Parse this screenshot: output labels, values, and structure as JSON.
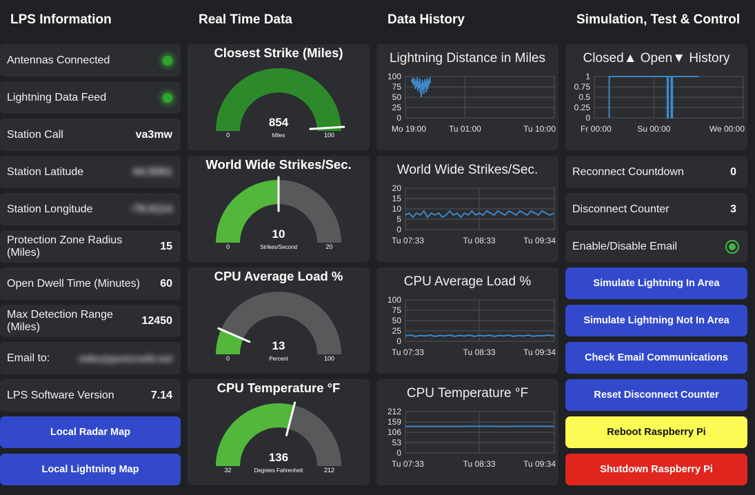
{
  "columns": {
    "info": "LPS Information",
    "realtime": "Real Time Data",
    "history": "Data History",
    "control": "Simulation, Test & Control"
  },
  "info": {
    "antennas": {
      "label": "Antennas Connected",
      "status": "connected",
      "color": "#2ea52e"
    },
    "feed": {
      "label": "Lightning Data Feed",
      "status": "connected",
      "color": "#2ea52e"
    },
    "call": {
      "label": "Station Call",
      "value": "va3mw"
    },
    "lat": {
      "label": "Station Latitude",
      "value": "44.5061"
    },
    "lon": {
      "label": "Station Longitude",
      "value": "-79.6114"
    },
    "radius": {
      "label": "Protection Zone Radius (Miles)",
      "value": "15"
    },
    "dwell": {
      "label": "Open Dwell Time (Minutes)",
      "value": "60"
    },
    "range": {
      "label": "Max Detection Range (Miles)",
      "value": "12450"
    },
    "email": {
      "label": "Email to:",
      "value": "mike@portcredit.net"
    },
    "version": {
      "label": "LPS Software Version",
      "value": "7.14"
    },
    "radar_btn": "Local Radar Map",
    "lightning_btn": "Local Lightning Map"
  },
  "gauges": [
    {
      "title": "Closest Strike (Miles)",
      "value": 854,
      "min": 0,
      "max": 100,
      "fill_fraction": 1.0,
      "needle_fraction": 0.98,
      "unit": "Miles",
      "color": "#2d8a2b",
      "track": "#58595b",
      "min_label": "0",
      "max_label": "100",
      "value_label": "854"
    },
    {
      "title": "World Wide Strikes/Sec.",
      "value": 10,
      "min": 0,
      "max": 20,
      "fill_fraction": 0.5,
      "needle_fraction": 0.5,
      "unit": "Strikes/Second",
      "color": "#52b73b",
      "track": "#58595b",
      "min_label": "0",
      "max_label": "20",
      "value_label": "10"
    },
    {
      "title": "CPU Average Load %",
      "value": 13,
      "min": 0,
      "max": 100,
      "fill_fraction": 0.13,
      "needle_fraction": 0.13,
      "unit": "Percent",
      "color": "#52b73b",
      "track": "#58595b",
      "min_label": "0",
      "max_label": "100",
      "value_label": "13"
    },
    {
      "title": "CPU Temperature °F",
      "value": 136,
      "min": 32,
      "max": 212,
      "fill_fraction": 0.58,
      "needle_fraction": 0.58,
      "unit": "Degrees Fahrenheit",
      "color": "#52b73b",
      "track": "#58595b",
      "min_label": "32",
      "max_label": "212",
      "value_label": "136"
    }
  ],
  "chart_data": [
    {
      "type": "line",
      "title": "Lightning Distance in Miles",
      "x_ticks": [
        "Mo 19:00",
        "Tu 01:00",
        "Tu 10:00"
      ],
      "y_ticks": [
        "100",
        "75",
        "50",
        "25",
        "0"
      ],
      "ylim": [
        0,
        100
      ],
      "xlim": [
        0,
        15
      ],
      "x_tick_pos": [
        0,
        6,
        15
      ],
      "series": [
        {
          "values": [
            [
              0.6,
              92
            ],
            [
              0.7,
              85
            ],
            [
              0.75,
              97
            ],
            [
              0.8,
              80
            ],
            [
              0.9,
              95
            ],
            [
              1.0,
              70
            ],
            [
              1.05,
              90
            ],
            [
              1.1,
              75
            ],
            [
              1.2,
              98
            ],
            [
              1.25,
              65
            ],
            [
              1.3,
              88
            ],
            [
              1.4,
              72
            ],
            [
              1.45,
              95
            ],
            [
              1.5,
              60
            ],
            [
              1.55,
              82
            ],
            [
              1.6,
              50
            ],
            [
              1.65,
              78
            ],
            [
              1.7,
              92
            ],
            [
              1.75,
              68
            ],
            [
              1.8,
              86
            ],
            [
              1.85,
              58
            ],
            [
              1.9,
              80
            ],
            [
              1.95,
              94
            ],
            [
              2.0,
              74
            ],
            [
              2.05,
              88
            ],
            [
              2.1,
              62
            ],
            [
              2.15,
              84
            ],
            [
              2.2,
              96
            ],
            [
              2.25,
              70
            ],
            [
              2.3,
              90
            ],
            [
              2.4,
              80
            ],
            [
              2.45,
              98
            ],
            [
              2.5,
              85
            ]
          ]
        }
      ]
    },
    {
      "type": "line",
      "title": "World Wide Strikes/Sec.",
      "x_ticks": [
        "Tu 07:33",
        "Tu 08:33",
        "Tu 09:34"
      ],
      "y_ticks": [
        "20",
        "15",
        "10",
        "5",
        "0"
      ],
      "ylim": [
        0,
        20
      ],
      "xlim": [
        0,
        121
      ],
      "x_tick_pos": [
        0,
        60,
        121
      ],
      "series": [
        {
          "values": [
            [
              0,
              7
            ],
            [
              3,
              8
            ],
            [
              6,
              6
            ],
            [
              9,
              8
            ],
            [
              12,
              7
            ],
            [
              15,
              9
            ],
            [
              18,
              6
            ],
            [
              21,
              8
            ],
            [
              24,
              7
            ],
            [
              27,
              8
            ],
            [
              30,
              6
            ],
            [
              33,
              7
            ],
            [
              36,
              9
            ],
            [
              39,
              7
            ],
            [
              42,
              8
            ],
            [
              45,
              6
            ],
            [
              48,
              8
            ],
            [
              51,
              7
            ],
            [
              54,
              9
            ],
            [
              57,
              7
            ],
            [
              60,
              8
            ],
            [
              63,
              7
            ],
            [
              66,
              9
            ],
            [
              69,
              8
            ],
            [
              72,
              7
            ],
            [
              75,
              9
            ],
            [
              78,
              8
            ],
            [
              81,
              7
            ],
            [
              84,
              9
            ],
            [
              87,
              8
            ],
            [
              90,
              7
            ],
            [
              93,
              9
            ],
            [
              96,
              8
            ],
            [
              99,
              7
            ],
            [
              102,
              9
            ],
            [
              105,
              8
            ],
            [
              108,
              7
            ],
            [
              111,
              9
            ],
            [
              114,
              8
            ],
            [
              117,
              7
            ],
            [
              121,
              8
            ]
          ]
        }
      ]
    },
    {
      "type": "line",
      "title": "CPU Average Load %",
      "x_ticks": [
        "Tu 07:33",
        "Tu 08:33",
        "Tu 09:34"
      ],
      "y_ticks": [
        "100",
        "75",
        "50",
        "25",
        "0"
      ],
      "ylim": [
        0,
        100
      ],
      "xlim": [
        0,
        121
      ],
      "x_tick_pos": [
        0,
        60,
        121
      ],
      "series": [
        {
          "values": [
            [
              0,
              13
            ],
            [
              4,
              15
            ],
            [
              8,
              12
            ],
            [
              12,
              14
            ],
            [
              16,
              13
            ],
            [
              20,
              15
            ],
            [
              24,
              12
            ],
            [
              28,
              14
            ],
            [
              32,
              13
            ],
            [
              36,
              15
            ],
            [
              40,
              12
            ],
            [
              44,
              14
            ],
            [
              48,
              13
            ],
            [
              52,
              15
            ],
            [
              56,
              12
            ],
            [
              60,
              14
            ],
            [
              64,
              13
            ],
            [
              68,
              15
            ],
            [
              72,
              12
            ],
            [
              76,
              14
            ],
            [
              80,
              13
            ],
            [
              84,
              15
            ],
            [
              88,
              12
            ],
            [
              92,
              14
            ],
            [
              96,
              13
            ],
            [
              100,
              15
            ],
            [
              104,
              12
            ],
            [
              108,
              14
            ],
            [
              112,
              13
            ],
            [
              116,
              15
            ],
            [
              121,
              13
            ]
          ]
        }
      ]
    },
    {
      "type": "line",
      "title": "CPU Temperature °F",
      "x_ticks": [
        "Tu 07:33",
        "Tu 08:33",
        "Tu 09:34"
      ],
      "y_ticks": [
        "212",
        "159",
        "106",
        "53",
        "0"
      ],
      "ylim": [
        0,
        212
      ],
      "xlim": [
        0,
        121
      ],
      "x_tick_pos": [
        0,
        60,
        121
      ],
      "series": [
        {
          "values": [
            [
              0,
              136
            ],
            [
              20,
              136
            ],
            [
              40,
              136
            ],
            [
              60,
              137
            ],
            [
              80,
              136
            ],
            [
              100,
              137
            ],
            [
              121,
              136
            ]
          ]
        }
      ]
    },
    {
      "type": "line",
      "title": "Closed▲ Open▼ History",
      "x_ticks": [
        "Fr 00:00",
        "Su 00:00",
        "We 00:00"
      ],
      "y_ticks": [
        "1",
        "0.75",
        "0.5",
        "0.25",
        "0"
      ],
      "ylim": [
        0,
        1
      ],
      "xlim": [
        0,
        5
      ],
      "x_tick_pos": [
        0,
        2,
        5
      ],
      "series": [
        {
          "values": [
            [
              0.5,
              0
            ],
            [
              0.5,
              1
            ],
            [
              2.45,
              1
            ],
            [
              2.45,
              0
            ],
            [
              2.48,
              0
            ],
            [
              2.48,
              1
            ],
            [
              2.58,
              1
            ],
            [
              2.58,
              0
            ],
            [
              2.62,
              0
            ],
            [
              2.62,
              1
            ],
            [
              3.5,
              1
            ]
          ]
        }
      ]
    }
  ],
  "control": {
    "reconnect": {
      "label": "Reconnect Countdown",
      "value": "0"
    },
    "disconnect": {
      "label": "Disconnect Counter",
      "value": "3"
    },
    "email_toggle": {
      "label": "Enable/Disable Email",
      "state": "on"
    },
    "buttons": {
      "simulate_in": "Simulate Lightning In Area",
      "simulate_not": "Simulate Lightning Not In Area",
      "check_email": "Check Email Communications",
      "reset_disconnect": "Reset Disconnect Counter",
      "reboot": "Reboot Raspberry Pi",
      "shutdown": "Shutdown Raspberry Pi"
    }
  }
}
